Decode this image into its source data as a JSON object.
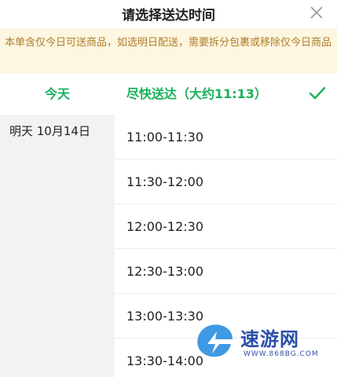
{
  "header": {
    "title": "请选择送达时间",
    "close_icon": "close-icon"
  },
  "notice": {
    "text": "本单含仅今日可送商品，如选明日配送，需要拆分包裹或移除仅今日商品"
  },
  "days": [
    {
      "label": "今天",
      "selected": true
    },
    {
      "label": "明天 10月14日",
      "selected": false
    }
  ],
  "slots": [
    {
      "label": "尽快送达（大约11:13）",
      "selected": true
    },
    {
      "label": "11:00-11:30"
    },
    {
      "label": "11:30-12:00"
    },
    {
      "label": "12:00-12:30"
    },
    {
      "label": "12:30-13:00"
    },
    {
      "label": "13:00-13:30"
    },
    {
      "label": "13:30-14:00"
    }
  ],
  "watermark": {
    "text": "速游网",
    "sub": "WWW.868BG.COM"
  },
  "colors": {
    "accent_green": "#19b05a",
    "notice_bg": "#fdf6e0",
    "notice_text": "#b07d2a",
    "left_panel_bg": "#f2f2f2"
  }
}
